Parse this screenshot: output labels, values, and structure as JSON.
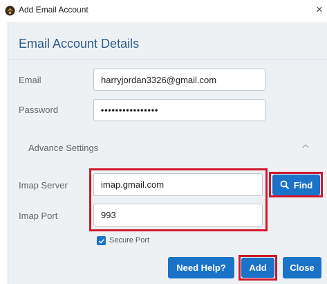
{
  "window": {
    "title": "Add Email Account",
    "close_glyph": "×"
  },
  "dialog": {
    "heading": "Email Account Details"
  },
  "form": {
    "email": {
      "label": "Email",
      "value": "harryjordan3326@gmail.com"
    },
    "password": {
      "label": "Password",
      "value": "••••••••••••••••"
    },
    "advance_settings": {
      "label": "Advance Settings",
      "expanded": true
    },
    "imap_server": {
      "label": "Imap Server",
      "value": "imap.gmail.com"
    },
    "imap_port": {
      "label": "Imap Port",
      "value": "993"
    },
    "secure_port": {
      "label": "Secure Port",
      "checked": true
    }
  },
  "buttons": {
    "find": "Find",
    "need_help": "Need Help?",
    "add": "Add",
    "close": "Close"
  },
  "colors": {
    "accent": "#1a73c9",
    "highlight": "#d0182c",
    "heading": "#2e5c8a"
  },
  "icons": [
    "app-icon",
    "close-icon",
    "chevron-up-icon",
    "search-icon",
    "checkmark-icon"
  ]
}
